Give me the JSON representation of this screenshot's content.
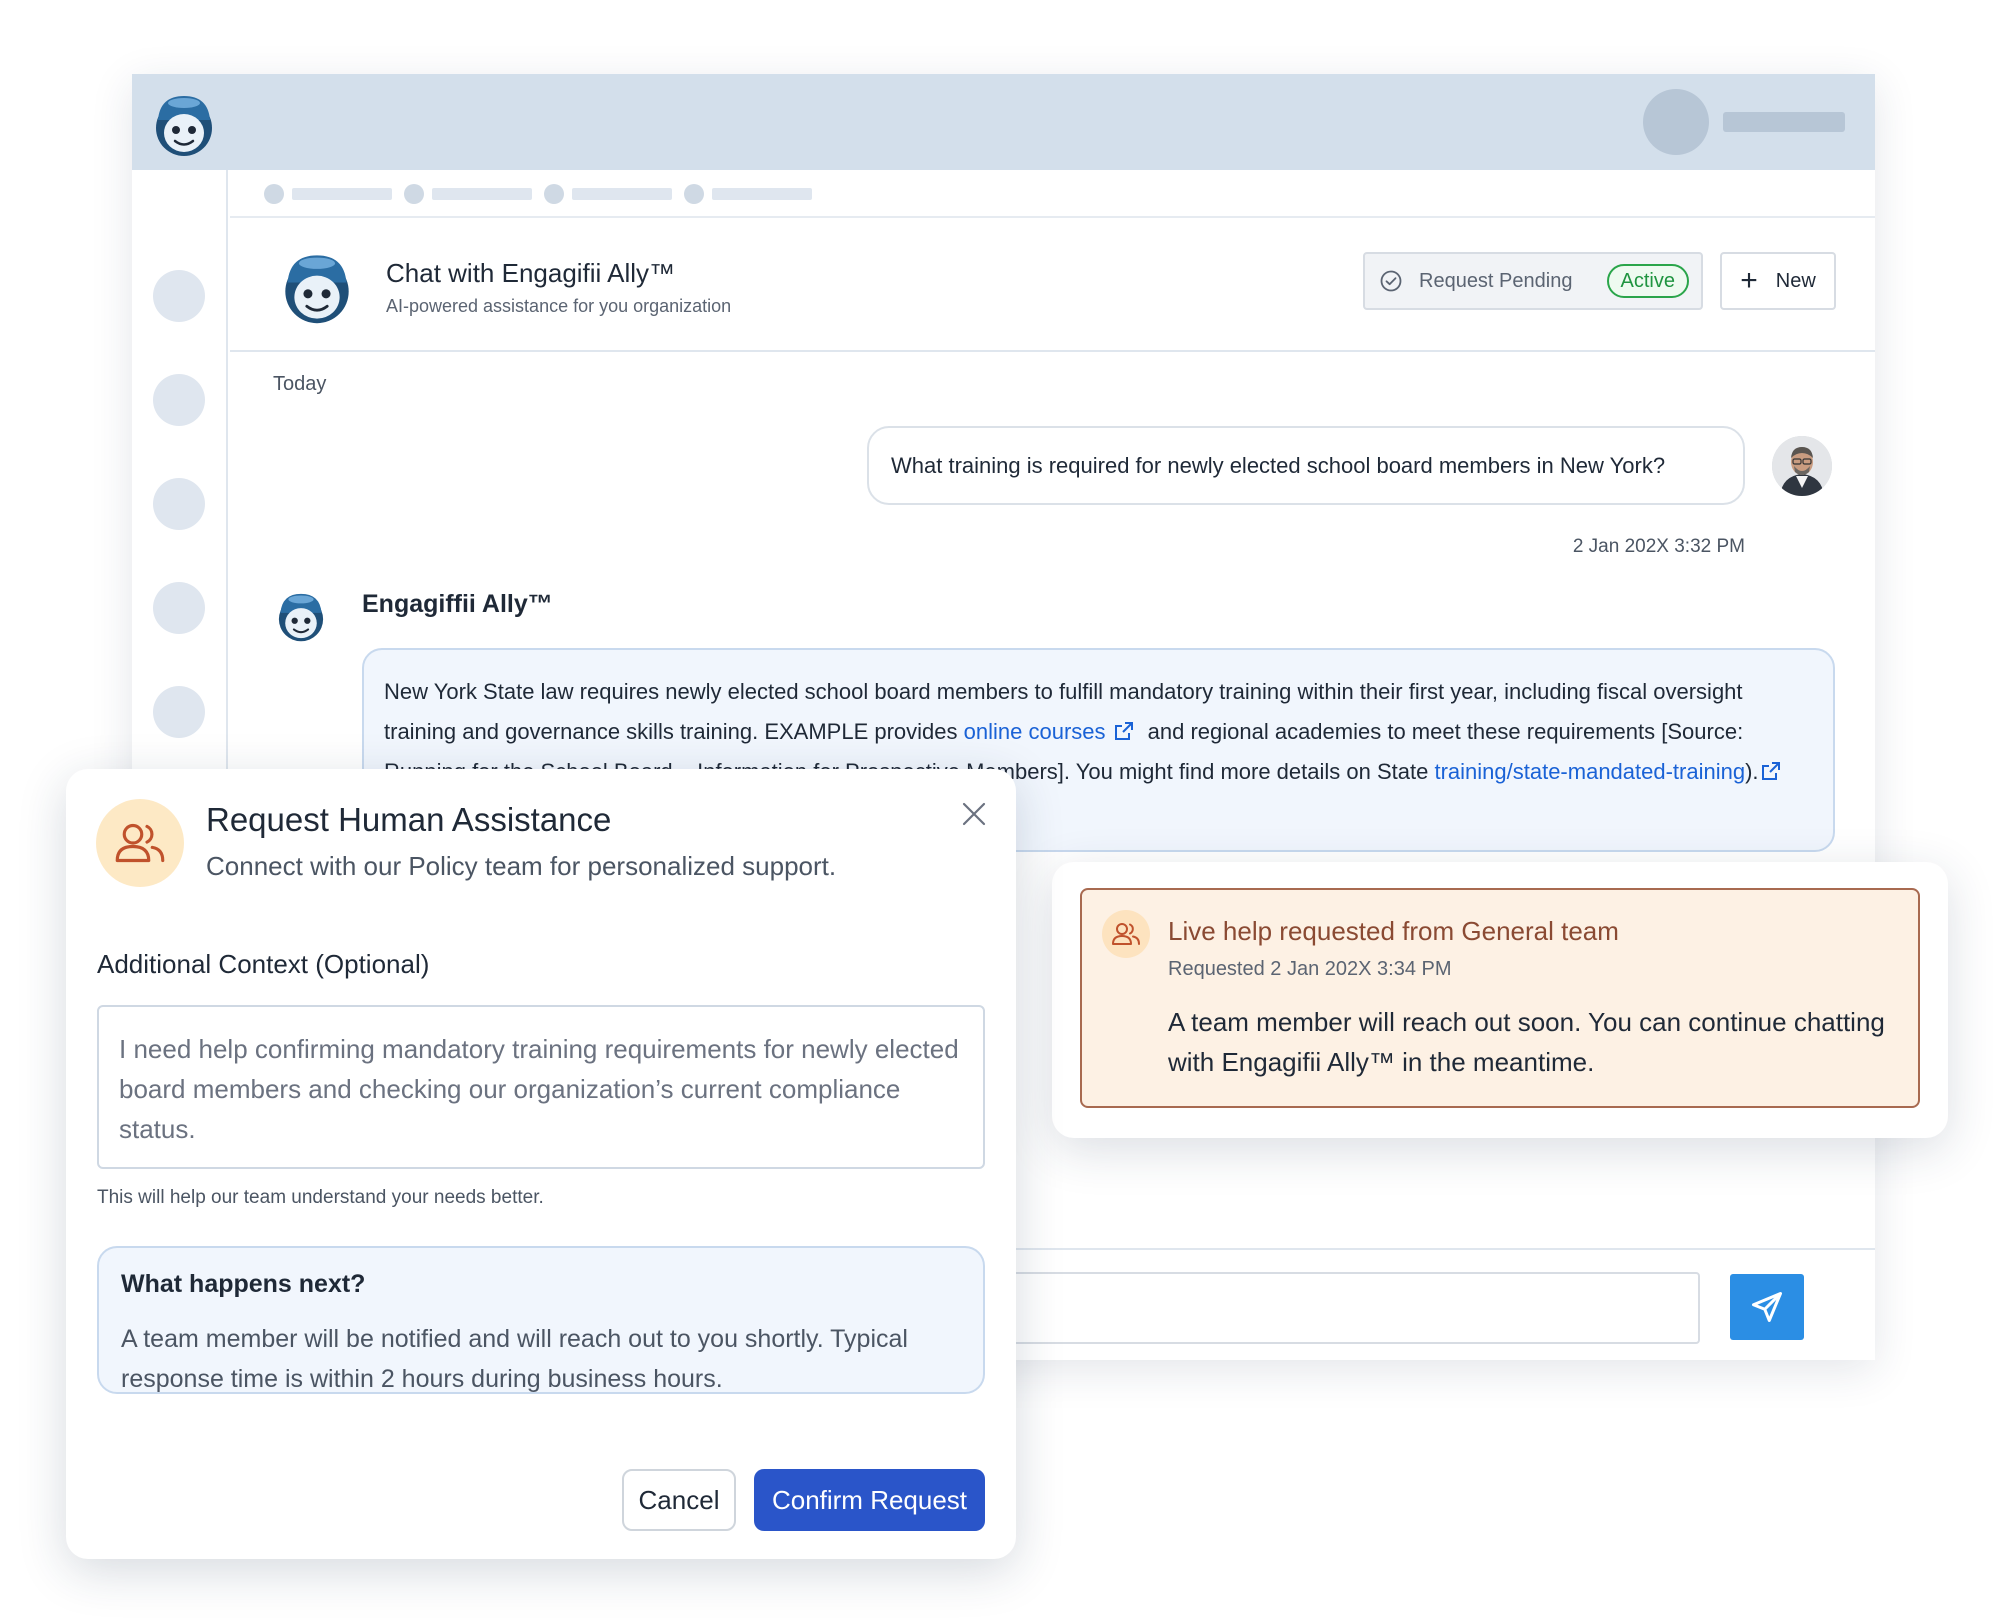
{
  "colors": {
    "header_bg": "#d3dfeb",
    "accent_blue": "#2a55c9",
    "send_blue": "#2b8ee4",
    "link_blue": "#1a62d6",
    "active_green": "#1f9440",
    "notice_border": "#a86a50",
    "notice_title": "#8a4a33"
  },
  "header": {
    "logo_icon": "mascot-logo-icon",
    "avatar_icon": "user-avatar-placeholder"
  },
  "chat": {
    "title": "Chat with Engagifii Ally™",
    "subtitle": "AI-powered assistance for you organization",
    "status_label": "Request Pending",
    "status_badge": "Active",
    "new_button": "New",
    "new_icon": "plus-icon"
  },
  "conversation": {
    "day_label": "Today",
    "user_message": "What training is required for newly elected school board members in New York?",
    "user_time": "2 Jan 202X 3:32 PM",
    "bot_name": "Engagiffii Ally™",
    "bot_text_1": "New York State law requires newly elected school board members to fulfill mandatory training within their first year, including fiscal oversight training and governance skills training. EXAMPLE provides ",
    "bot_link_1": "online courses",
    "bot_text_2": " and regional academies to meet these requirements [Source: Running for the School Board – Information for Prospective Members]. You might find more details on State ",
    "bot_link_2": "training/state-mandated-training",
    "bot_text_3": ")."
  },
  "composer": {
    "send_icon": "send-icon"
  },
  "modal": {
    "icon": "people-icon",
    "title": "Request Human Assistance",
    "subtitle": "Connect with our Policy team for personalized support.",
    "context_label": "Additional Context (Optional)",
    "context_value": "I need help confirming mandatory training requirements for newly elected board members and checking our organization’s current compliance status.",
    "help_text": "This will help our team understand your needs better.",
    "next_title": "What happens next?",
    "next_body": "A team member will be notified and will reach out to you shortly. Typical response time is within 2 hours during business hours.",
    "cancel_label": "Cancel",
    "confirm_label": "Confirm Request"
  },
  "notice": {
    "icon": "people-icon",
    "title": "Live help requested from General team",
    "time": "Requested 2 Jan 202X 3:34 PM",
    "body": "A team member will reach out soon. You can continue chatting with Engagifii Ally™ in the meantime."
  }
}
